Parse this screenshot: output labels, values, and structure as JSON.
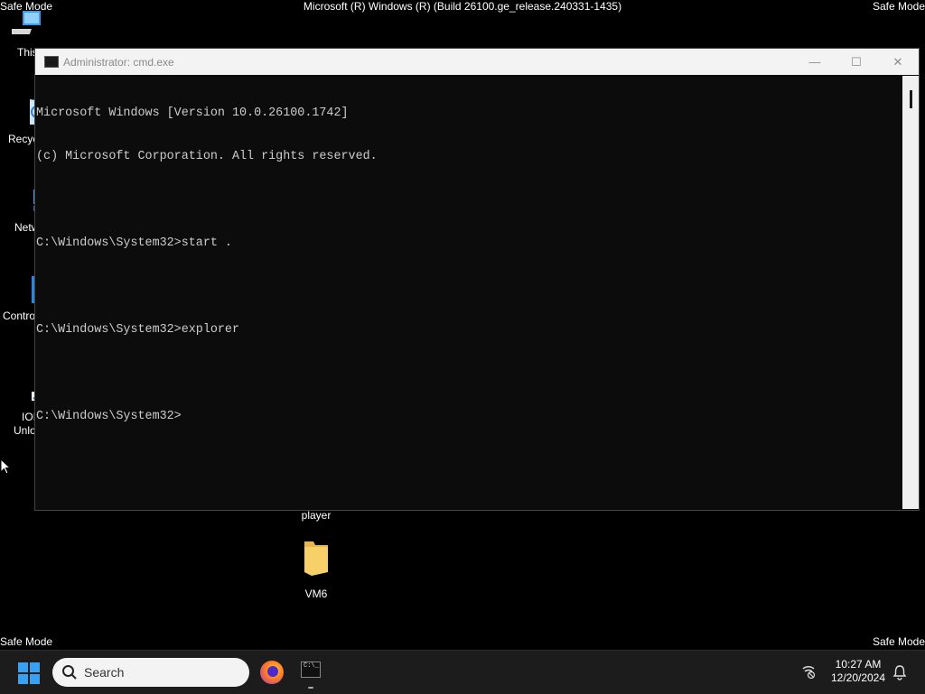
{
  "desktop": {
    "safe_mode": "Safe Mode",
    "build_text": "Microsoft (R) Windows (R) (Build 26100.ge_release.240331-1435)",
    "icons": [
      {
        "label": "This",
        "icon": "pc-icon"
      },
      {
        "label": "Recyc",
        "icon": "recycle-bin-icon"
      },
      {
        "label": "Netw",
        "icon": "network-icon"
      },
      {
        "label": "Contro",
        "icon": "control-panel-icon"
      },
      {
        "label": "IOI",
        "label2": "Unlo",
        "icon": "shortcut-gear-icon"
      },
      {
        "label": "player"
      },
      {
        "label": "VM6",
        "icon": "folder-icon"
      }
    ]
  },
  "window": {
    "title": "Administrator: cmd.exe",
    "console_lines": [
      "Microsoft Windows [Version 10.0.26100.1742]",
      "(c) Microsoft Corporation. All rights reserved.",
      "",
      "C:\\Windows\\System32>start .",
      "",
      "C:\\Windows\\System32>explorer",
      "",
      "C:\\Windows\\System32>"
    ],
    "controls": {
      "minimize": "—",
      "maximize": "☐",
      "close": "✕"
    }
  },
  "taskbar": {
    "search_placeholder": "Search",
    "time": "10:27 AM",
    "date": "12/20/2024",
    "cmd_icon_text": "C:\\_"
  }
}
